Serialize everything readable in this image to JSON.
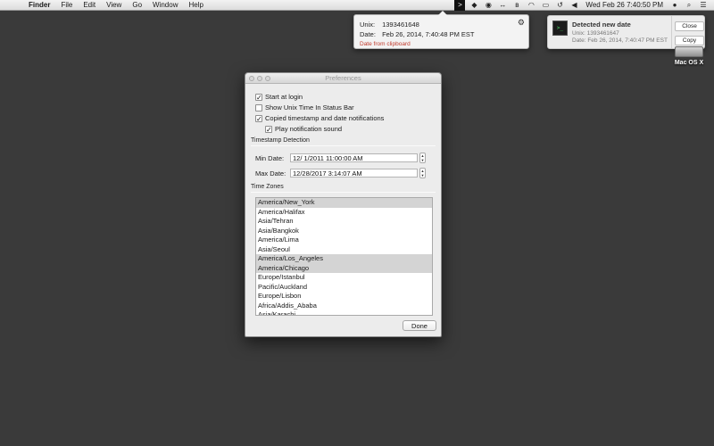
{
  "menubar": {
    "apple_glyph": "",
    "items": [
      "Finder",
      "File",
      "Edit",
      "View",
      "Go",
      "Window",
      "Help"
    ],
    "clock": "Wed Feb 26  7:40:50 PM"
  },
  "popover": {
    "unix_label": "Unix:",
    "unix_value": "1393461648",
    "date_label": "Date:",
    "date_value": "Feb 26, 2014, 7:40:48 PM EST",
    "source": "Date from clipboard"
  },
  "notification": {
    "title": "Detected new date",
    "unix_line": "Unix: 1393461647",
    "date_line": "Date: Feb 26, 2014, 7:40:47 PM EST",
    "close_label": "Close",
    "copy_label": "Copy"
  },
  "desktop": {
    "disk_label": "Mac OS X"
  },
  "preferences": {
    "title": "Preferences",
    "start_at_login": "Start at login",
    "show_unix_time": "Show Unix Time In Status Bar",
    "copied_notifications": "Copied timestamp and date notifications",
    "play_sound": "Play notification sound",
    "timestamp_section": "Timestamp Detection",
    "min_date_label": "Min Date:",
    "min_date_value": "12/  1/2011 11:00:00 AM",
    "max_date_label": "Max Date:",
    "max_date_value": "12/28/2017   3:14:07 AM",
    "timezones_section": "Time Zones",
    "timezones": [
      {
        "name": "America/New_York",
        "selected": true
      },
      {
        "name": "America/Halifax",
        "selected": false
      },
      {
        "name": "Asia/Tehran",
        "selected": false
      },
      {
        "name": "Asia/Bangkok",
        "selected": false
      },
      {
        "name": "America/Lima",
        "selected": false
      },
      {
        "name": "Asia/Seoul",
        "selected": false
      },
      {
        "name": "America/Los_Angeles",
        "selected": true
      },
      {
        "name": "America/Chicago",
        "selected": true
      },
      {
        "name": "Europe/Istanbul",
        "selected": false
      },
      {
        "name": "Pacific/Auckland",
        "selected": false
      },
      {
        "name": "Europe/Lisbon",
        "selected": false
      },
      {
        "name": "Africa/Addis_Ababa",
        "selected": false
      },
      {
        "name": "Asia/Karachi",
        "selected": false
      }
    ],
    "done_label": "Done"
  },
  "checkboxes": {
    "start_at_login": true,
    "show_unix_time": false,
    "copied_notifications": true,
    "play_sound": true
  },
  "icons": [
    "apple-icon",
    "timestamp-app-icon",
    "dropbox-icon",
    "eye-icon",
    "bluetooth-icon",
    "wifi-icon",
    "airplay-icon",
    "time-machine-icon",
    "volume-icon",
    "user-icon",
    "spotlight-icon",
    "notification-center-icon",
    "gear-icon"
  ]
}
